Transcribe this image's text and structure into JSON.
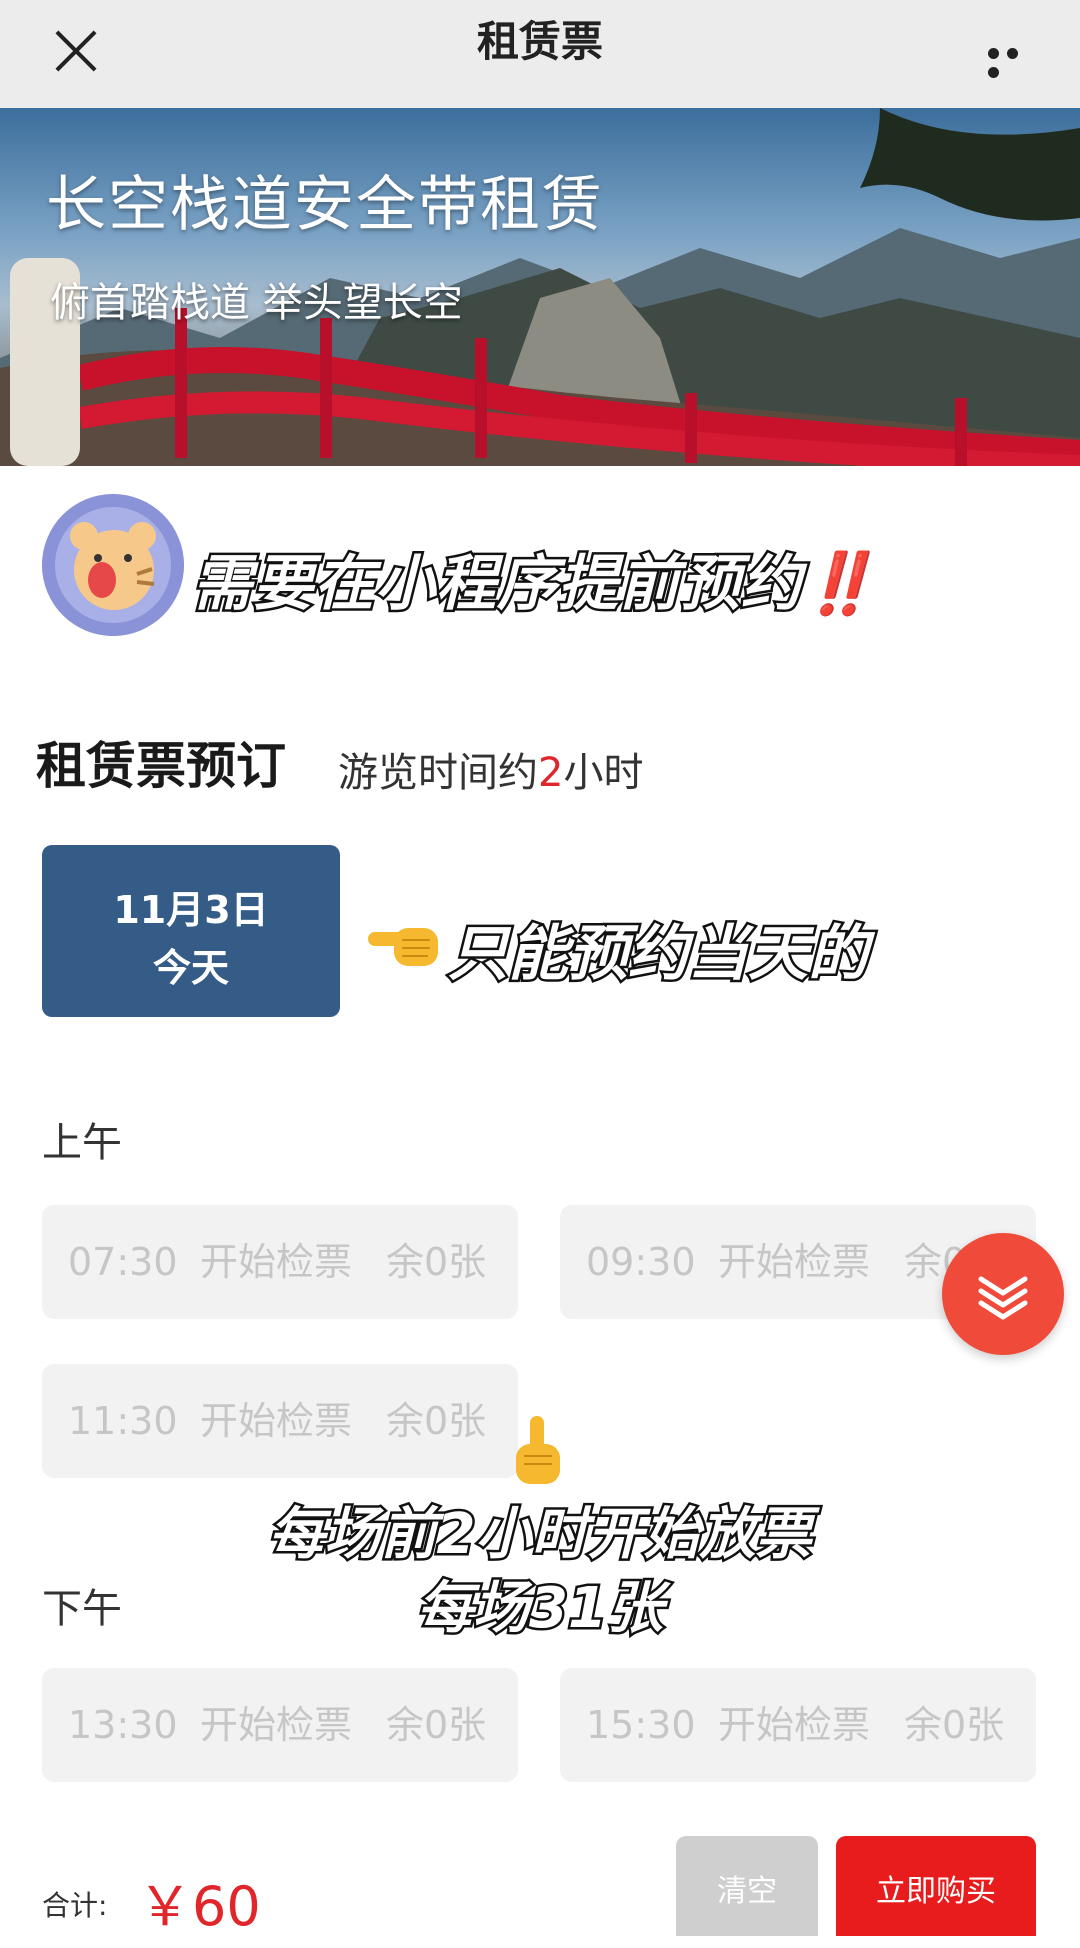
{
  "nav": {
    "title": "租赁票"
  },
  "banner": {
    "title": "长空栈道安全带租赁",
    "subtitle": "俯首踏栈道 举头望长空"
  },
  "notice": {
    "text": "需要在小程序提前预约",
    "emphasis": "‼️"
  },
  "booking": {
    "heading": "租赁票预订",
    "note_prefix": "游览时间约",
    "note_hours": "2",
    "note_suffix": "小时"
  },
  "date": {
    "label": "11月3日",
    "sub": "今天"
  },
  "annotations": {
    "date_note": "只能预约当天的",
    "release_line1": "每场前2小时开始放票",
    "release_line2": "每场31张"
  },
  "morning": {
    "label": "上午",
    "slots": [
      {
        "time": "07:30",
        "status": "开始检票",
        "remaining": "余0张"
      },
      {
        "time": "09:30",
        "status": "开始检票",
        "remaining": "余0张"
      },
      {
        "time": "11:30",
        "status": "开始检票",
        "remaining": "余0张"
      }
    ]
  },
  "afternoon": {
    "label": "下午",
    "slots": [
      {
        "time": "13:30",
        "status": "开始检票",
        "remaining": "余0张"
      },
      {
        "time": "15:30",
        "status": "开始检票",
        "remaining": "余0张"
      }
    ]
  },
  "footer": {
    "total_label": "合计:",
    "total_value": "￥60",
    "clear_label": "清空",
    "buy_label": "立即购买"
  },
  "colors": {
    "accent_red": "#e0262b",
    "date_card": "#345c86",
    "buy_button": "#e81c1c",
    "float_button": "#ef4a3a"
  },
  "icons": {
    "close": "close-icon",
    "more": "more-icon",
    "collapse": "double-chevron-down-icon",
    "pointing_left": "hand-pointing-left-icon",
    "pointing_up": "hand-pointing-up-icon"
  }
}
